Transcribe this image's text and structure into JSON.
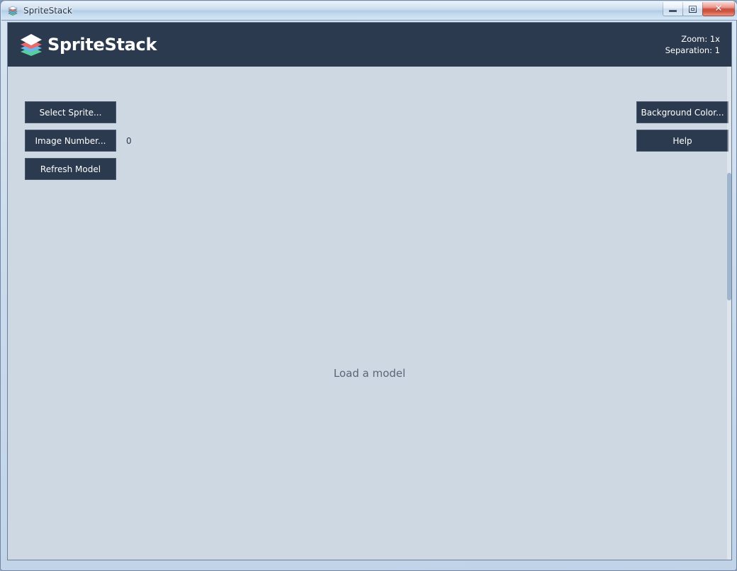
{
  "window": {
    "title": "SpriteStack",
    "icon": "spritestack-logo-icon",
    "controls": {
      "minimize_label": "Minimize",
      "maximize_label": "Maximize",
      "close_label": "Close",
      "close_glyph": "✕"
    }
  },
  "app_header": {
    "brand_name": "SpriteStack",
    "logo_icon": "stacked-layers-icon",
    "status": {
      "zoom": "Zoom: 1x",
      "separation": "Separation: 1"
    }
  },
  "toolbar": {
    "select_sprite_label": "Select Sprite...",
    "image_number_label": "Image Number...",
    "image_number_value": "0",
    "refresh_model_label": "Refresh Model",
    "background_color_label": "Background Color...",
    "help_label": "Help"
  },
  "viewport": {
    "message": "Load a model"
  },
  "colors": {
    "header_navy": "#2b3a4f",
    "button_navy": "#2b3a4f",
    "button_border": "#46566d",
    "client_background": "#ced8e2",
    "viewport_text": "#5a6576",
    "logo_layer_white": "#ffffff",
    "logo_layer_red": "#e96a6a",
    "logo_layer_blue": "#69b6e8",
    "logo_layer_green": "#57cf9c",
    "close_button_red": "#c33523"
  }
}
